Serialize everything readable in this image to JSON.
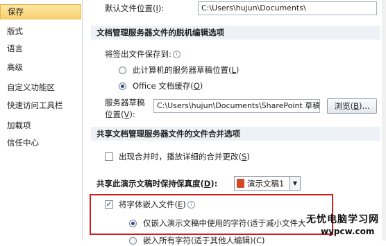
{
  "sidebar": {
    "items": [
      {
        "label": "保存",
        "active": true
      },
      {
        "label": "版式"
      },
      {
        "label": "语言"
      },
      {
        "label": "高级"
      },
      {
        "label": "自定义功能区"
      },
      {
        "label": "快速访问工具栏"
      },
      {
        "label": "加载项"
      },
      {
        "label": "信任中心"
      }
    ]
  },
  "main": {
    "default_location_label": "默认文件位置(",
    "default_location_key": "I",
    "default_location_label_end": "):",
    "default_location_value": "C:\\Users\\hujun\\Documents\\",
    "offline_section": "文档管理服务器文件的脱机编辑选项",
    "checkout_label": "将签出文件保存到:",
    "radio_server_drafts": "此计算机的服务器草稿位置(",
    "radio_server_drafts_key": "L",
    "radio_office_cache": "Office 文档缓存(",
    "radio_office_cache_key": "O",
    "server_drafts_label_1": "服务器草稿",
    "server_drafts_label_2": "位置(",
    "server_drafts_label_2_key": "V",
    "server_drafts_label_2_end": "):",
    "server_drafts_value": "C:\\Users\\hujun\\Documents\\SharePoint 草稿\\",
    "browse_button": "浏览(",
    "browse_key": "B",
    "browse_end": ")...",
    "merge_section": "共享文档管理服务器文件的文件合并选项",
    "merge_checkbox": "出现合并时，播放详细的合并更改(",
    "merge_key": "S",
    "fidelity_label": "共享此演示文稿时保持保真度(",
    "fidelity_key": "D",
    "fidelity_doc": "演示文稿1",
    "embed_checkbox": "将字体嵌入文件(",
    "embed_key": "E",
    "embed_only_used": "仅嵌入演示文稿中使用的字符(适于减小文件大",
    "embed_all": "嵌入所有字符(适于其他人编辑)(C)"
  },
  "watermark": {
    "cn": "无忧电脑学习网",
    "en": "wypcw.com"
  },
  "colors": {
    "active_item": "#f9d16d",
    "section_header_bg": "#eef1f5",
    "highlight_border": "#cc1f1f"
  }
}
